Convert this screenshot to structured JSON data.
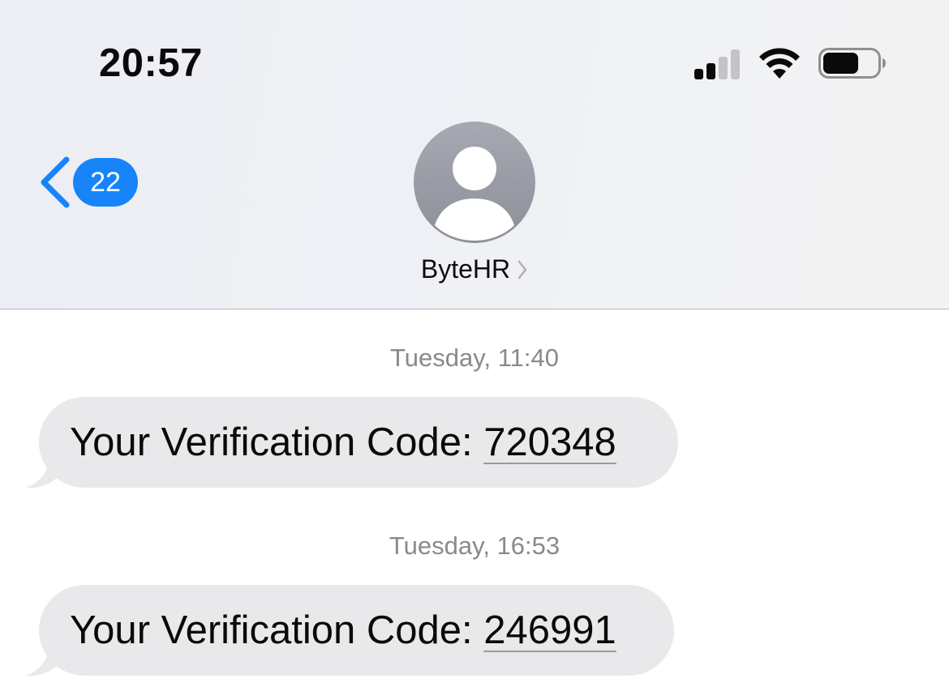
{
  "status_bar": {
    "time": "20:57",
    "signal_bars_active": 2,
    "signal_bars_total": 4,
    "wifi": "wifi-icon",
    "battery_level": 0.65
  },
  "nav": {
    "back_icon": "chevron-left-icon",
    "unread_count": "22",
    "contact_name": "ByteHR",
    "contact_chevron": "chevron-right-icon",
    "avatar_icon": "person-silhouette-icon"
  },
  "messages": [
    {
      "timestamp": "Tuesday, 11:40",
      "text_prefix": "Your Verification Code: ",
      "code": "720348"
    },
    {
      "timestamp": "Tuesday, 16:53",
      "text_prefix": "Your Verification Code: ",
      "code": "246991"
    }
  ],
  "colors": {
    "accent": "#1784fa",
    "bubble_received": "#e9e9eb",
    "timestamp_text": "#8a8a8e",
    "avatar": "#9a9da5"
  }
}
